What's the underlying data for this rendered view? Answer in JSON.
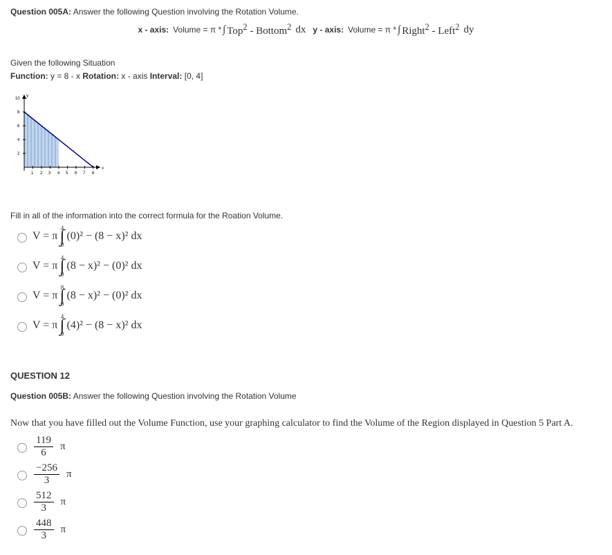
{
  "q5a": {
    "title_bold": "Question 005A:",
    "title_rest": " Answer the following Question involving the Rotation Volume.",
    "xaxis_label": "x - axis:",
    "xaxis_vol": "Volume = π *",
    "xaxis_int_body": "Top",
    "xaxis_minus": " - Bottom",
    "xaxis_dx": "dx",
    "yaxis_label": "y - axis:",
    "yaxis_vol": "Volume = π *",
    "yaxis_int_body": "Right",
    "yaxis_minus": " - Left",
    "yaxis_dy": "dy",
    "given": "Given the following Situation",
    "func_label": "Function:",
    "func_val": " y = 8 - x ",
    "rot_label": "Rotation:",
    "rot_val": " x - axis ",
    "int_label": "Interval:",
    "int_val": " [0, 4]",
    "fillin": "Fill in all of the information into the correct formula for the Roation Volume.",
    "options": [
      {
        "pre": "V = π ",
        "top": "4",
        "bot": "0",
        "body": "(0)² − (8 − x)² dx"
      },
      {
        "pre": "V = π ",
        "top": "4",
        "bot": "0",
        "body": "(8 − x)² − (0)² dx"
      },
      {
        "pre": "V = π ",
        "top": "8",
        "bot": "0",
        "body": "(8 − x)² − (0)² dx"
      },
      {
        "pre": "V = π ",
        "top": "4",
        "bot": "0",
        "body": "(4)² − (8 − x)² dx"
      }
    ]
  },
  "q12": {
    "num": "QUESTION 12",
    "title_bold": "Question 005B:",
    "title_rest": " Answer the following Question involving the Rotation Volume",
    "now": "Now that you have filled out the Volume Function, use your graphing calculator to find the Volume of the Region displayed in Question 5 Part A.",
    "options": [
      {
        "top": "119",
        "bot": "6",
        "pi": "π"
      },
      {
        "top": "−256",
        "bot": "3",
        "pi": "π"
      },
      {
        "top": "512",
        "bot": "3",
        "pi": "π"
      },
      {
        "top": "448",
        "bot": "3",
        "pi": "π"
      }
    ]
  },
  "chart_data": {
    "type": "area",
    "title": "",
    "xlabel": "x",
    "ylabel": "y",
    "xlim": [
      0,
      8
    ],
    "ylim": [
      0,
      10
    ],
    "x_ticks": [
      1,
      2,
      3,
      4,
      5,
      6,
      7,
      8
    ],
    "y_ticks": [
      2,
      4,
      6,
      8,
      10
    ],
    "series": [
      {
        "name": "y = 8 - x",
        "x": [
          0,
          8
        ],
        "y": [
          8,
          0
        ]
      }
    ],
    "shaded_region": {
      "x": [
        0,
        4,
        4,
        0
      ],
      "y": [
        8,
        4,
        0,
        0
      ]
    },
    "grid": true
  }
}
